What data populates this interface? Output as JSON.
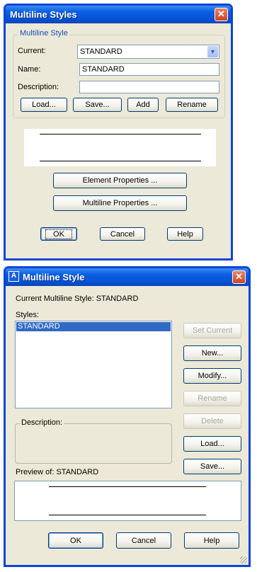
{
  "dialog1": {
    "title": "Multiline Styles",
    "group_title": "Multiline Style",
    "current_label": "Current:",
    "current_value": "STANDARD",
    "name_label": "Name:",
    "name_value": "STANDARD",
    "description_label": "Description:",
    "description_value": "",
    "buttons": {
      "load": "Load...",
      "save": "Save...",
      "add": "Add",
      "rename": "Rename",
      "element_properties": "Element Properties ...",
      "multiline_properties": "Multiline Properties ...",
      "ok": "OK",
      "cancel": "Cancel",
      "help": "Help"
    }
  },
  "dialog2": {
    "title": "Multiline Style",
    "current_style_text": "Current Multiline Style: STANDARD",
    "styles_label": "Styles:",
    "styles": [
      "STANDARD"
    ],
    "selected_style": "STANDARD",
    "description_label": "Description:",
    "preview_label": "Preview of: STANDARD",
    "buttons": {
      "set_current": "Set Current",
      "new": "New...",
      "modify": "Modify...",
      "rename": "Rename",
      "delete": "Delete",
      "load": "Load...",
      "save": "Save...",
      "ok": "OK",
      "cancel": "Cancel",
      "help": "Help"
    }
  },
  "colors": {
    "titlebar": "#0554d7",
    "dialog_face": "#ece9d8",
    "selection": "#316ac5",
    "close_button": "#d0431f"
  }
}
